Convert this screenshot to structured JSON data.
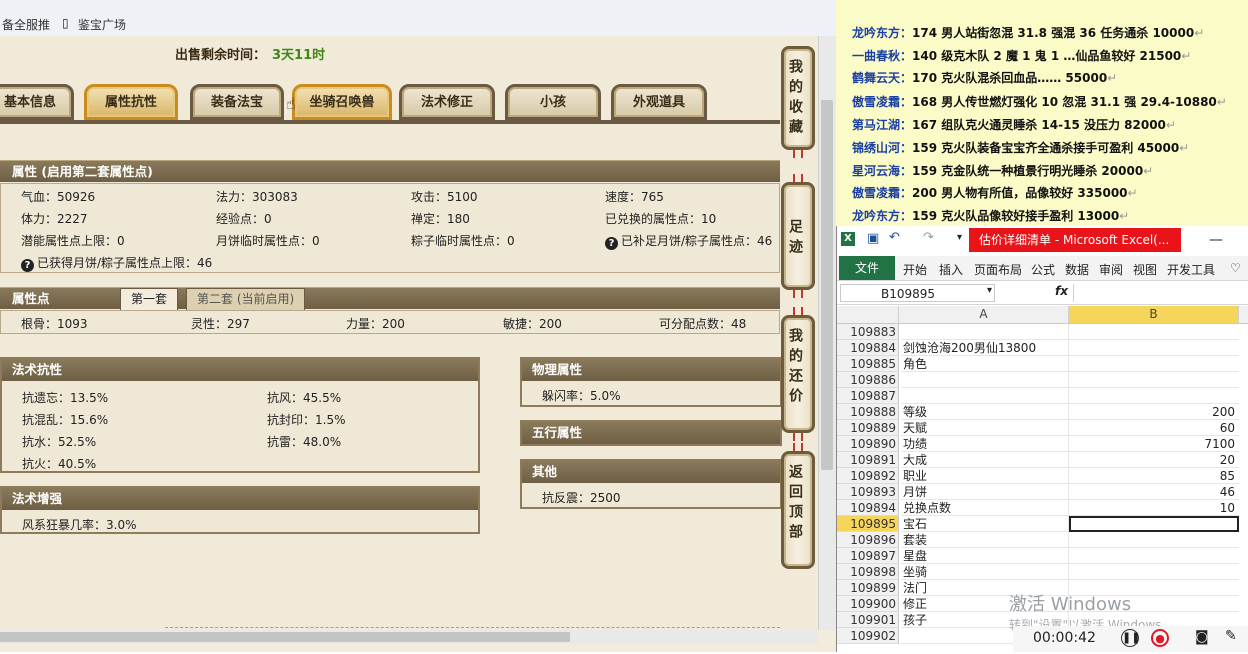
{
  "bookmarks": [
    "备全服推",
    "鉴宝广场"
  ],
  "game": {
    "sale_time_label": "出售剩余时间：",
    "sale_time_value": "3天11时",
    "tabs": [
      "基本信息",
      "属性抗性",
      "装备法宝",
      "坐骑召唤兽",
      "法术修正",
      "小孩",
      "外观道具"
    ],
    "active_tab": "属性抗性",
    "attr_section_title": "属性 (启用第二套属性点)",
    "attributes": [
      [
        "气血：50926",
        "法力：303083",
        "攻击：5100",
        "速度：765"
      ],
      [
        "体力：2227",
        "经验点：0",
        "禅定：180",
        "已兑换的属性点：10"
      ],
      [
        "潜能属性点上限：0",
        "月饼临时属性点：0",
        "粽子临时属性点：0",
        "已补足月饼/粽子属性点：46"
      ]
    ],
    "attr_note": "已获得月饼/粽子属性点上限：46",
    "points_title": "属性点",
    "points_tabs": [
      "第一套",
      "第二套 (当前启用)"
    ],
    "points": [
      "根骨：1093",
      "灵性：297",
      "力量：200",
      "敏捷：200",
      "可分配点数：48"
    ],
    "resist_title": "法术抗性",
    "resists": [
      [
        "抗遗忘：13.5%",
        "抗风：45.5%"
      ],
      [
        "抗混乱：15.6%",
        "抗封印：1.5%"
      ],
      [
        "抗水：52.5%",
        "抗雷：48.0%"
      ],
      [
        "抗火：40.5%",
        ""
      ]
    ],
    "enhance_title": "法术增强",
    "enhance": "风系狂暴几率：3.0%",
    "physical_title": "物理属性",
    "physical": "躲闪率：5.0%",
    "five_title": "五行属性",
    "other_title": "其他",
    "other": "抗反震：2500",
    "side_buttons": [
      "我的收藏",
      "足迹",
      "我的还价",
      "返回顶部"
    ]
  },
  "chat_lines": [
    {
      "who": "龙吟东方：",
      "text": "174 男人站街忽混 31.8 强混 36 任务通杀 10000"
    },
    {
      "who": "一曲春秋：",
      "text": "140 级克木队 2 魔 1 鬼 1 …仙品鱼较好 21500"
    },
    {
      "who": "鹤舞云天：",
      "text": "170 克火队混杀回血品…… 55000"
    },
    {
      "who": "傲雪凌霜：",
      "text": "168 男人传世燃灯强化 10 忽混 31.1 强 29.4-10880"
    },
    {
      "who": "第马江湖：",
      "text": "167 组队克火通灵睡杀 14-15 没压力 82000"
    },
    {
      "who": "锦绣山河：",
      "text": "159 克火队装备宝宝齐全通杀接手可盈利 45000"
    },
    {
      "who": "星河云海：",
      "text": "159 克金队统一种植景行明光睡杀 20000"
    },
    {
      "who": "傲雪凌霜：",
      "text": "200 男人物有所值，品像较好 335000"
    },
    {
      "who": "龙吟东方：",
      "text": "159 克火队品像较好接手盈利 13000"
    }
  ],
  "excel": {
    "title": "估价详细清单 - Microsoft Excel(...",
    "file_tab": "文件",
    "menus": [
      "开始",
      "插入",
      "页面布局",
      "公式",
      "数据",
      "审阅",
      "视图",
      "开发工具"
    ],
    "name_box": "B109895",
    "fx": "fx",
    "col_a": "A",
    "col_b": "B",
    "rows": [
      {
        "n": "109883",
        "a": "",
        "b": ""
      },
      {
        "n": "109884",
        "a": "剑蚀沧海200男仙13800",
        "b": ""
      },
      {
        "n": "109885",
        "a": "角色",
        "b": ""
      },
      {
        "n": "109886",
        "a": "",
        "b": ""
      },
      {
        "n": "109887",
        "a": "",
        "b": ""
      },
      {
        "n": "109888",
        "a": "等级",
        "b": "200"
      },
      {
        "n": "109889",
        "a": "天赋",
        "b": "60"
      },
      {
        "n": "109890",
        "a": "功绩",
        "b": "7100"
      },
      {
        "n": "109891",
        "a": "大成",
        "b": "20"
      },
      {
        "n": "109892",
        "a": "职业",
        "b": "85"
      },
      {
        "n": "109893",
        "a": "月饼",
        "b": "46"
      },
      {
        "n": "109894",
        "a": "兑换点数",
        "b": "10"
      },
      {
        "n": "109895",
        "a": "宝石",
        "b": ""
      },
      {
        "n": "109896",
        "a": "套装",
        "b": ""
      },
      {
        "n": "109897",
        "a": "星盘",
        "b": ""
      },
      {
        "n": "109898",
        "a": "坐骑",
        "b": ""
      },
      {
        "n": "109899",
        "a": "法门",
        "b": ""
      },
      {
        "n": "109900",
        "a": "修正",
        "b": ""
      },
      {
        "n": "109901",
        "a": "孩子",
        "b": ""
      },
      {
        "n": "109902",
        "a": "",
        "b": ""
      }
    ],
    "selected_row": "109895",
    "watermark": "激活 Windows",
    "watermark_sub": "转到\"设置\"以激活 Windows。",
    "record_time": "00:00:42"
  }
}
